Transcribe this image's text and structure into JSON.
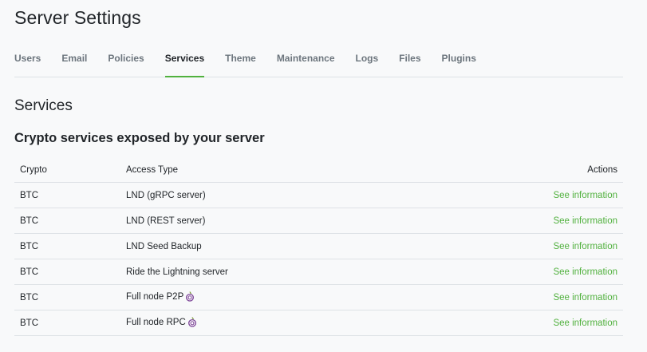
{
  "page": {
    "title": "Server Settings"
  },
  "tabs": [
    {
      "label": "Users",
      "active": false
    },
    {
      "label": "Email",
      "active": false
    },
    {
      "label": "Policies",
      "active": false
    },
    {
      "label": "Services",
      "active": true
    },
    {
      "label": "Theme",
      "active": false
    },
    {
      "label": "Maintenance",
      "active": false
    },
    {
      "label": "Logs",
      "active": false
    },
    {
      "label": "Files",
      "active": false
    },
    {
      "label": "Plugins",
      "active": false
    }
  ],
  "section": {
    "title": "Services",
    "subtitle": "Crypto services exposed by your server"
  },
  "table": {
    "headers": {
      "crypto": "Crypto",
      "access_type": "Access Type",
      "actions": "Actions"
    },
    "rows": [
      {
        "crypto": "BTC",
        "access_type": "LND (gRPC server)",
        "action": "See information",
        "tor_icon": false
      },
      {
        "crypto": "BTC",
        "access_type": "LND (REST server)",
        "action": "See information",
        "tor_icon": false
      },
      {
        "crypto": "BTC",
        "access_type": "LND Seed Backup",
        "action": "See information",
        "tor_icon": false
      },
      {
        "crypto": "BTC",
        "access_type": "Ride the Lightning server",
        "action": "See information",
        "tor_icon": false
      },
      {
        "crypto": "BTC",
        "access_type": "Full node P2P",
        "action": "See information",
        "tor_icon": true
      },
      {
        "crypto": "BTC",
        "access_type": "Full node RPC",
        "action": "See information",
        "tor_icon": true
      }
    ]
  },
  "icons": {
    "tor": "tor-onion-icon"
  },
  "colors": {
    "accent": "#51b13e",
    "muted": "#6c757d",
    "border": "#dee2e6",
    "background": "#f8f9fa"
  }
}
